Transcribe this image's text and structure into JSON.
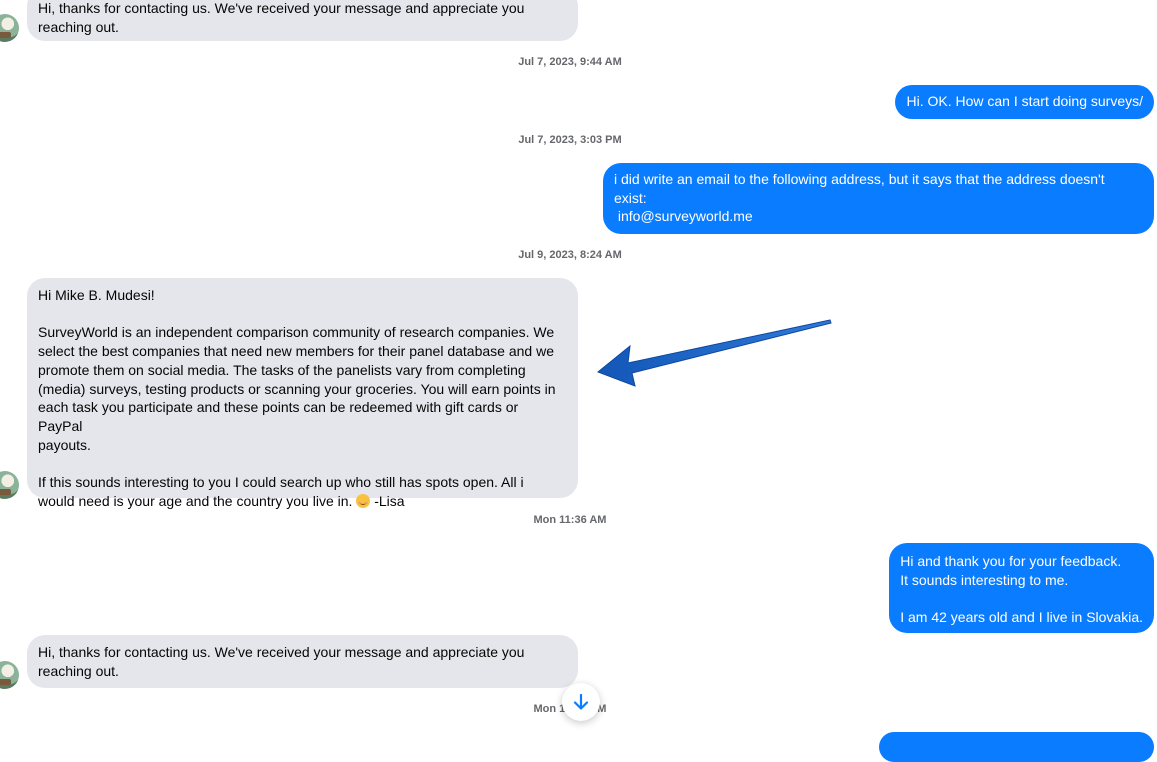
{
  "messages": {
    "m1": [
      "Hi, thanks for contacting us. We've received your message and appreciate you",
      "reaching out."
    ],
    "ts1": "Jul 7, 2023, 9:44 AM",
    "m2": "Hi. OK. How can I start doing surveys/",
    "ts2": "Jul 7, 2023, 3:03 PM",
    "m3": [
      "i did write an email to the following address, but it says that the address doesn't",
      "exist:",
      " info@surveyworld.me"
    ],
    "ts3": "Jul 9, 2023, 8:24 AM",
    "m4": {
      "greeting": "Hi Mike B. Mudesi!",
      "para1": [
        "SurveyWorld is an independent comparison community of research companies. We",
        "select the best companies that need new members for their panel database and we",
        "promote them on social media. The tasks of the panelists vary from completing",
        "(media) surveys, testing products or scanning your groceries. You will earn points in",
        "each task you participate and these points can be redeemed with gift cards or PayPal",
        "payouts."
      ],
      "para2_line1": "If this sounds interesting to you I could search up who still has spots open. All i",
      "para2_line2": "would need is your age and the country you live in.",
      "signoff": " -Lisa"
    },
    "ts4": "Mon 11:36 AM",
    "m5": [
      "Hi and thank you for your feedback.",
      "It sounds interesting to me.",
      "",
      "I am 42 years old and I live in Slovakia."
    ],
    "m6": [
      "Hi, thanks for contacting us. We've received your message and appreciate you",
      "reaching out."
    ],
    "ts5": "Mon 11:36 AM"
  },
  "icons": {
    "emoji": "smiling-face-emoji",
    "scroll": "arrow-down-icon",
    "annotation": "blue-arrow-annotation"
  },
  "colors": {
    "outgoing_bubble": "#0a7cff",
    "incoming_bubble": "#e4e6eb",
    "arrow": "#1565c0"
  }
}
